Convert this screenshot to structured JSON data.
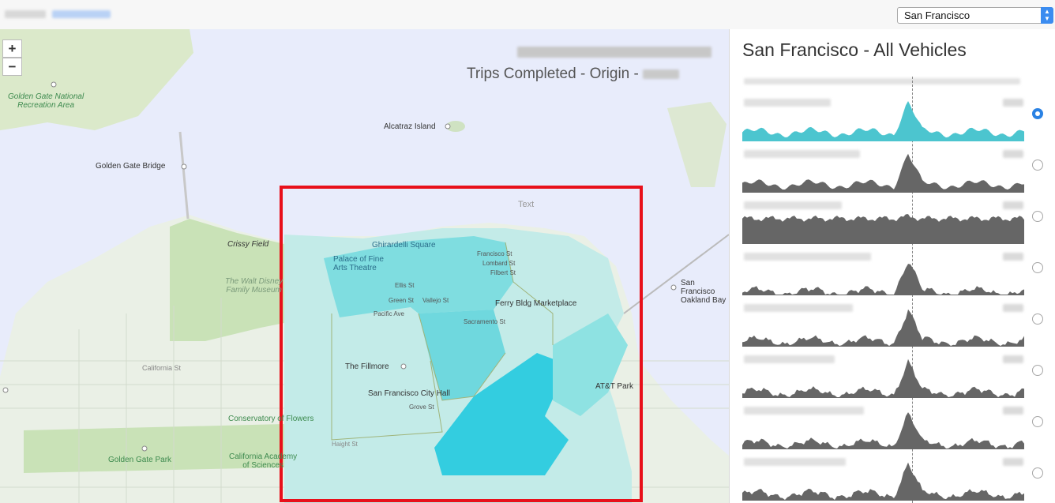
{
  "header": {
    "city_selected": "San Francisco"
  },
  "map": {
    "zoom_in": "+",
    "zoom_out": "−",
    "overlay_subtitle": "Trips Completed - Origin -",
    "highlight_text": "Text",
    "highlight_color": "#e8101a",
    "labels": {
      "golden_gate_nra": "Golden Gate National\nRecreation Area",
      "golden_gate_bridge": "Golden Gate Bridge",
      "alcatraz": "Alcatraz Island",
      "crissy_field": "Crissy Field",
      "ghirardelli": "Ghirardelli Square",
      "palace": "Palace of Fine\nArts Theatre",
      "walt_disney": "The Walt Disney\nFamily Museum",
      "fillmore": "The Fillmore",
      "city_hall": "San Francisco City Hall",
      "ferry": "Ferry Bldg Marketplace",
      "att_park": "AT&T Park",
      "bay_bridge": "San Francisco\nOakland Bay",
      "conservatory": "Conservatory of Flowers",
      "golden_gate_park": "Golden Gate Park",
      "academy": "California Academy\nof Sciences",
      "california_st": "California St",
      "green_st": "Green St",
      "pacific_ave": "Pacific Ave",
      "sacramento_st": "Sacramento St",
      "lombard_st": "Lombard St",
      "filbert_st": "Filbert St",
      "francisco_st": "Francisco St",
      "grove_st": "Grove St",
      "haight_st": "Haight St",
      "ellis_st": "Ellis St",
      "vallejo_st": "Vallejo St"
    }
  },
  "sidebar": {
    "title": "San Francisco - All Vehicles",
    "charts": [
      {
        "color": "#4cc5cf",
        "selected": true
      },
      {
        "color": "#666666",
        "selected": false
      },
      {
        "color": "#666666",
        "selected": false
      },
      {
        "color": "#666666",
        "selected": false
      },
      {
        "color": "#666666",
        "selected": false
      },
      {
        "color": "#666666",
        "selected": false
      },
      {
        "color": "#666666",
        "selected": false
      },
      {
        "color": "#666666",
        "selected": false
      }
    ]
  }
}
